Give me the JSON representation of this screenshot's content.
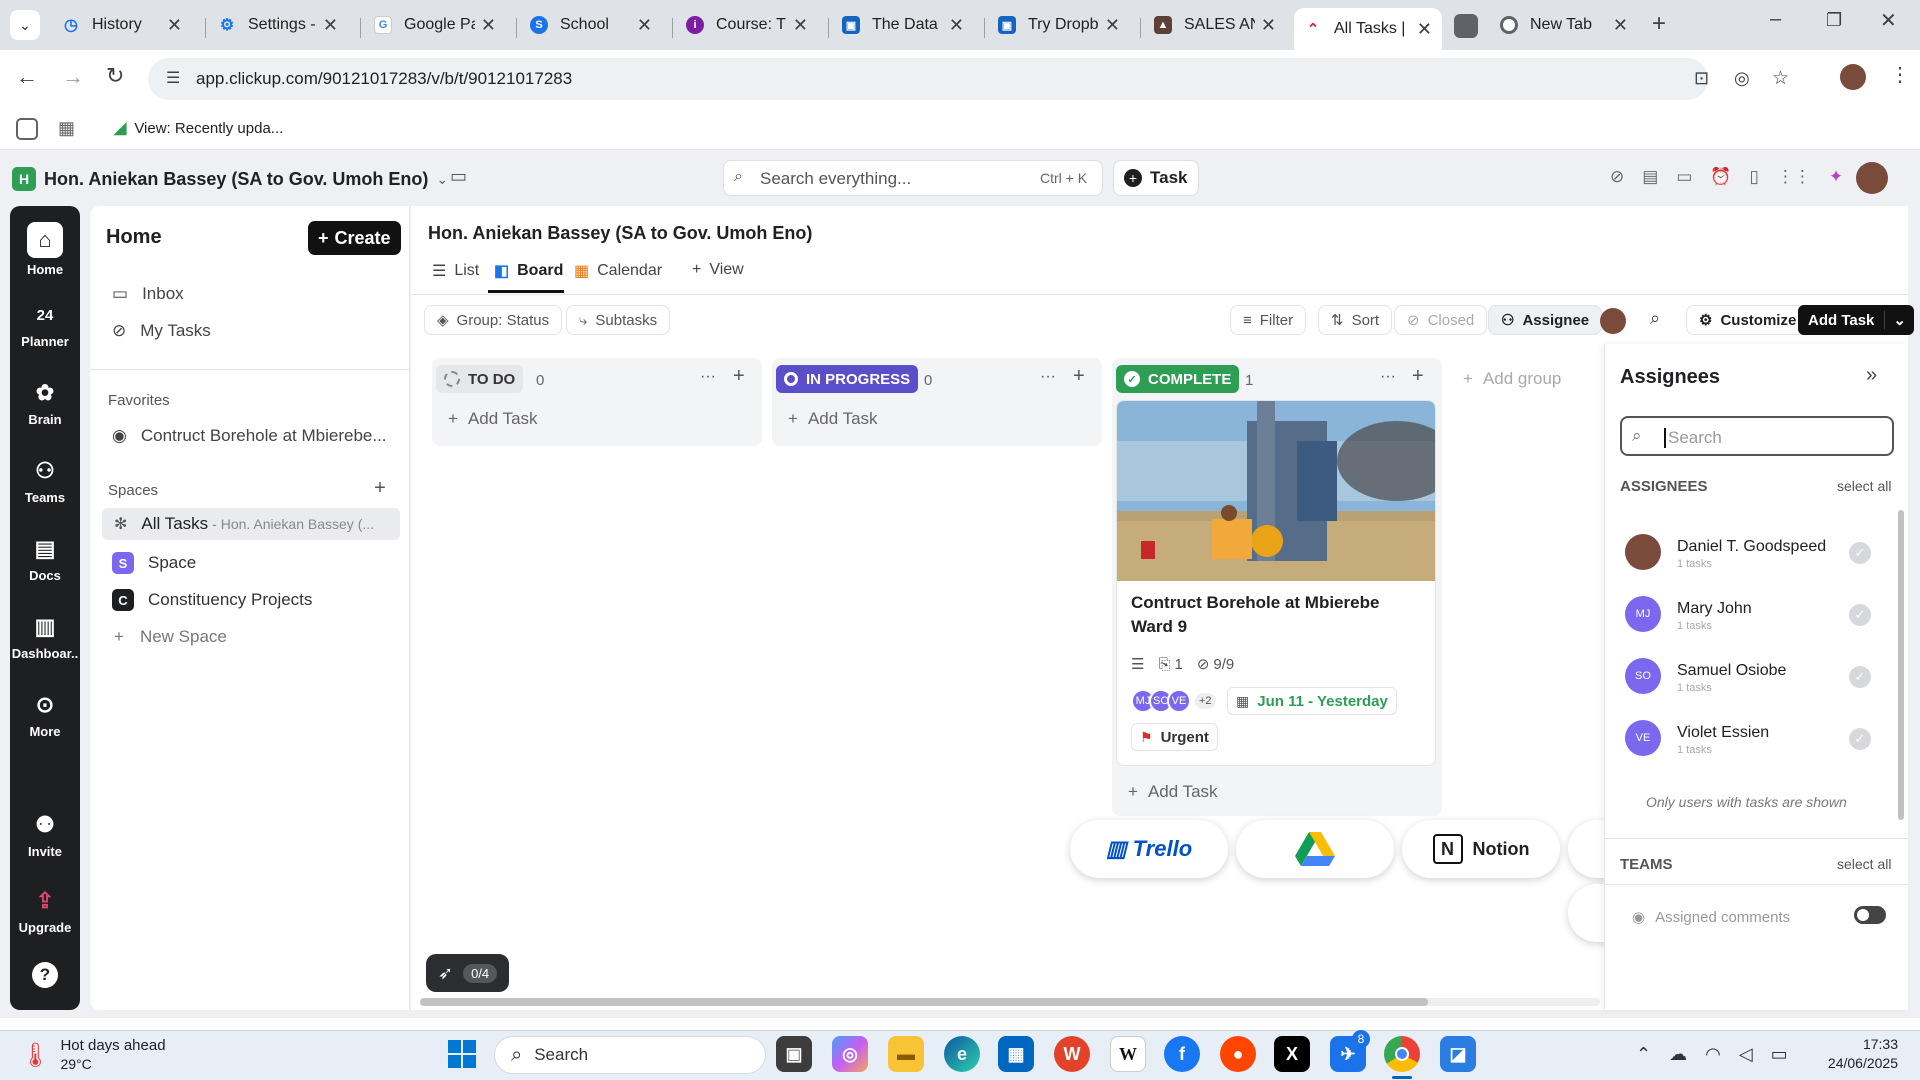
{
  "browser": {
    "tabs": [
      {
        "title": "History",
        "color": "#1a73e8",
        "icon": "history-icon"
      },
      {
        "title": "Settings - ",
        "color": "#1a73e8",
        "icon": "gear-icon"
      },
      {
        "title": "Google Pa",
        "color": "#4285f4",
        "icon": "google-pay-icon"
      },
      {
        "title": "School",
        "color": "#1a73e8",
        "icon": "skype-icon"
      },
      {
        "title": "Course: Th",
        "color": "#7b1fa2",
        "icon": "course-icon"
      },
      {
        "title": "The Data ",
        "color": "#1565c0",
        "icon": "form-icon"
      },
      {
        "title": "Try Dropb",
        "color": "#1565c0",
        "icon": "form-icon"
      },
      {
        "title": "SALES AN",
        "color": "#5d4037",
        "icon": "sales-icon"
      },
      {
        "title": "All Tasks |",
        "color": "#e91e63",
        "icon": "clickup-icon"
      },
      {
        "title": "New Tab",
        "color": "#5f6368",
        "icon": "chrome-icon"
      }
    ],
    "url": "app.clickup.com/90121017283/v/b/t/90121017283",
    "bookmark": "View: Recently upda..."
  },
  "workspace": {
    "initial": "H",
    "name": "Hon. Aniekan Bassey (SA to Gov. Umoh Eno)",
    "search_placeholder": "Search everything...",
    "search_shortcut": "Ctrl + K",
    "task_button": "Task"
  },
  "rail": [
    {
      "label": "Home"
    },
    {
      "label": "Planner",
      "icon_text": "24"
    },
    {
      "label": "Brain"
    },
    {
      "label": "Teams"
    },
    {
      "label": "Docs"
    },
    {
      "label": "Dashboar.."
    },
    {
      "label": "More"
    },
    {
      "label": "Invite"
    },
    {
      "label": "Upgrade"
    }
  ],
  "sidebar": {
    "title": "Home",
    "create": "Create",
    "inbox": "Inbox",
    "my_tasks": "My Tasks",
    "favorites_header": "Favorites",
    "favorite_item": "Contruct Borehole at Mbierebe...",
    "spaces_header": "Spaces",
    "all_tasks": "All Tasks",
    "all_tasks_sub": "- Hon. Aniekan Bassey (...",
    "spaces": [
      {
        "initial": "S",
        "name": "Space",
        "color": "#7b68ee"
      },
      {
        "initial": "C",
        "name": "Constituency Projects",
        "color": "#1e1f21"
      }
    ],
    "new_space": "New Space"
  },
  "main": {
    "title": "Hon. Aniekan Bassey (SA to Gov. Umoh Eno)",
    "views": [
      "List",
      "Board",
      "Calendar",
      "View"
    ],
    "group": "Group: Status",
    "subtasks": "Subtasks",
    "filter": "Filter",
    "sort": "Sort",
    "closed": "Closed",
    "assignee": "Assignee",
    "customize": "Customize",
    "add_task": "Add Task"
  },
  "columns": [
    {
      "status": "TO DO",
      "count": "0",
      "color": "#e6e7ea",
      "text": "#333"
    },
    {
      "status": "IN PROGRESS",
      "count": "0",
      "color": "#5b4ec9",
      "text": "#fff"
    },
    {
      "status": "COMPLETE",
      "count": "1",
      "color": "#2e9e55",
      "text": "#fff"
    }
  ],
  "add_task_label": "Add Task",
  "add_group": "Add group",
  "card": {
    "title": "Contruct Borehole at Mbierebe Ward 9",
    "attachments": "1",
    "checklist": "9/9",
    "date": "Jun 11 - Yesterday",
    "priority": "Urgent",
    "avatars": [
      "MJ",
      "SO",
      "VE"
    ],
    "more": "+2"
  },
  "integrations": [
    "Trello",
    "Notion"
  ],
  "assignees_panel": {
    "title": "Assignees",
    "search_placeholder": "Search",
    "section": "ASSIGNEES",
    "select_all": "select all",
    "people": [
      {
        "name": "Daniel T. Goodspeed",
        "tasks": "1 tasks",
        "initials": ""
      },
      {
        "name": "Mary John",
        "tasks": "1 tasks",
        "initials": "MJ"
      },
      {
        "name": "Samuel Osiobe",
        "tasks": "1 tasks",
        "initials": "SO"
      },
      {
        "name": "Violet Essien",
        "tasks": "1 tasks",
        "initials": "VE"
      }
    ],
    "note": "Only users with tasks are shown",
    "teams": "TEAMS",
    "teams_select_all": "select all",
    "assigned_comments": "Assigned comments"
  },
  "rocket_progress": "0/4",
  "taskbar": {
    "weather_title": "Hot days ahead",
    "weather_temp": "29°C",
    "search": "Search",
    "time": "17:33",
    "date": "24/06/2025",
    "badge": "8"
  }
}
